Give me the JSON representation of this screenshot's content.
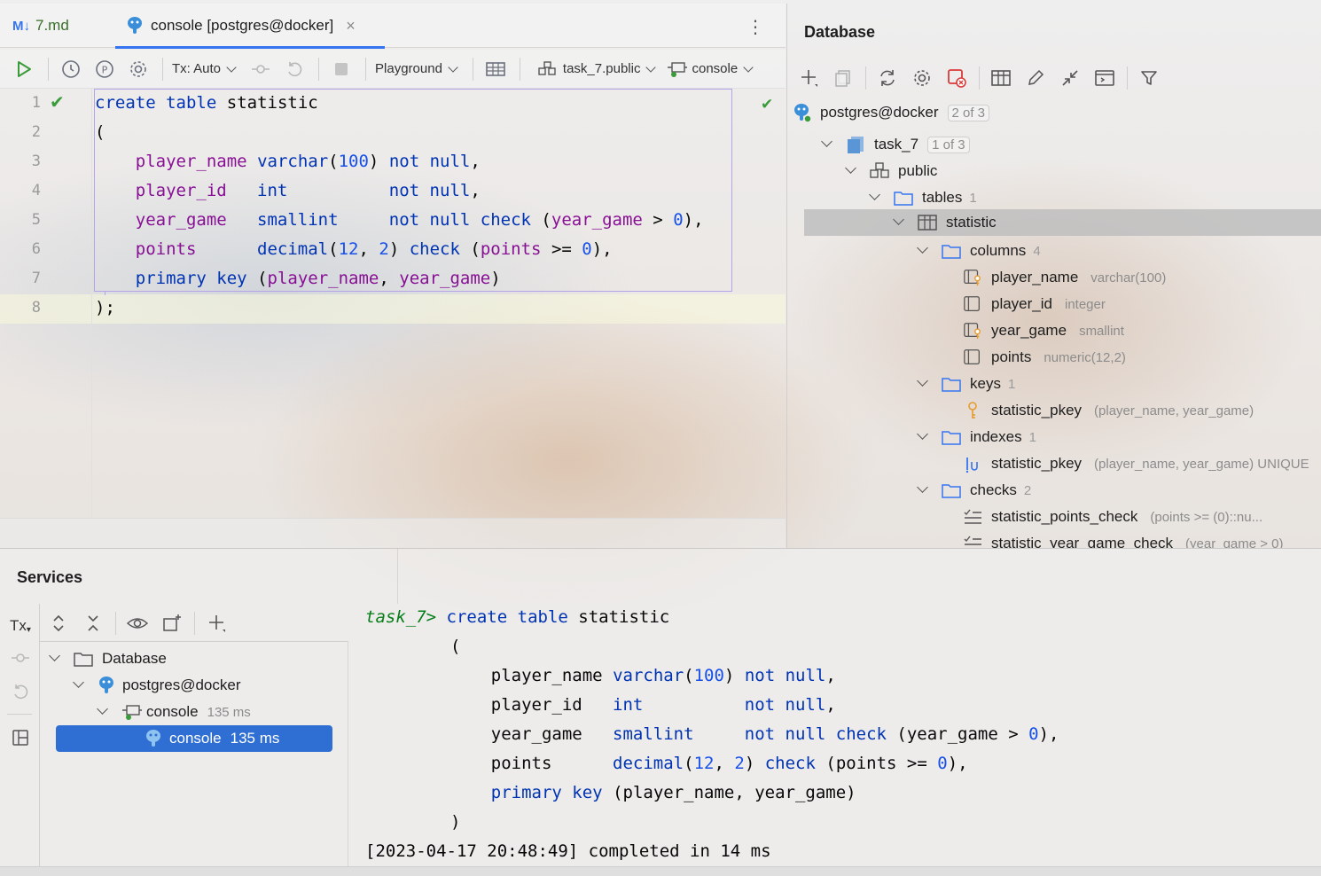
{
  "editor_tabs": [
    {
      "icon": "markdown-icon",
      "icon_text": "M↓",
      "label": "7.md",
      "active": false
    },
    {
      "icon": "postgres-icon",
      "label": "console [postgres@docker]",
      "active": true,
      "close": "×"
    }
  ],
  "editor_toolbar": {
    "tx_mode": "Tx: Auto",
    "mode": "Playground",
    "schema": "task_7.public",
    "session": "console"
  },
  "editor": {
    "line_numbers": [
      "1",
      "2",
      "3",
      "4",
      "5",
      "6",
      "7",
      "8"
    ]
  },
  "database_panel": {
    "title": "Database",
    "tree": {
      "datasource": {
        "label": "postgres@docker",
        "badge": "2 of 3"
      },
      "database": {
        "label": "task_7",
        "badge": "1 of 3"
      },
      "schema": {
        "label": "public"
      },
      "tables_folder": {
        "label": "tables",
        "count": "1"
      },
      "table": {
        "label": "statistic"
      },
      "columns_folder": {
        "label": "columns",
        "count": "4"
      },
      "columns": [
        {
          "name": "player_name",
          "type": "varchar(100)",
          "icon": "column-key-icon"
        },
        {
          "name": "player_id",
          "type": "integer",
          "icon": "column-icon"
        },
        {
          "name": "year_game",
          "type": "smallint",
          "icon": "column-key-icon"
        },
        {
          "name": "points",
          "type": "numeric(12,2)",
          "icon": "column-icon"
        }
      ],
      "keys_folder": {
        "label": "keys",
        "count": "1"
      },
      "keys": [
        {
          "name": "statistic_pkey",
          "detail": "(player_name, year_game)"
        }
      ],
      "indexes_folder": {
        "label": "indexes",
        "count": "1"
      },
      "indexes": [
        {
          "name": "statistic_pkey",
          "detail": "(player_name, year_game) UNIQUE"
        }
      ],
      "checks_folder": {
        "label": "checks",
        "count": "2"
      },
      "checks": [
        {
          "name": "statistic_points_check",
          "detail": "(points >= (0)::nu..."
        },
        {
          "name": "statistic_year_game_check",
          "detail": "(year_game > 0)"
        }
      ]
    }
  },
  "services": {
    "title": "Services",
    "tx_label": "Tx",
    "tree": {
      "root": {
        "label": "Database"
      },
      "datasource": {
        "label": "postgres@docker"
      },
      "session": {
        "label": "console",
        "time": "135 ms"
      },
      "selected": {
        "label": "console",
        "time": "135 ms"
      }
    },
    "output": {
      "prompt": "task_7>",
      "status": "[2023-04-17 20:48:49] completed in 14 ms"
    }
  },
  "colors": {
    "keyword": "#0033b3",
    "identifier": "#871094",
    "number": "#1750eb",
    "prompt": "#067d17",
    "selection": "#2f6fd3",
    "accent": "#3574f0"
  }
}
